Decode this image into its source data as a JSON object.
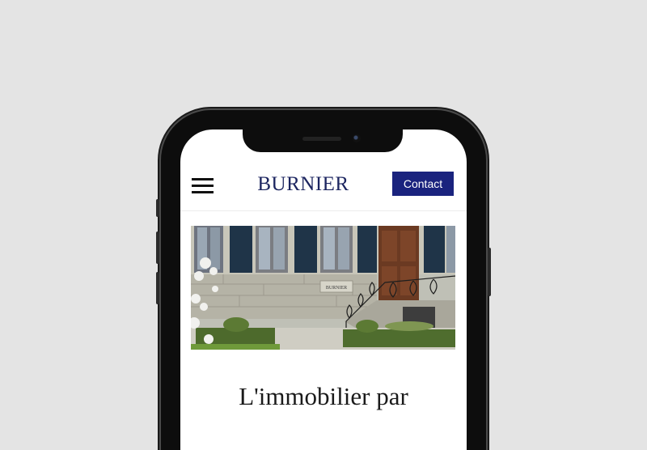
{
  "header": {
    "logo": "BURNIER",
    "contact_label": "Contact"
  },
  "hero": {
    "plaque": "BURNIER"
  },
  "headline": "L'immobilier par",
  "colors": {
    "brand_navy": "#1a237e",
    "logo_navy": "#1c2560",
    "shutter_blue": "#1f3448"
  }
}
